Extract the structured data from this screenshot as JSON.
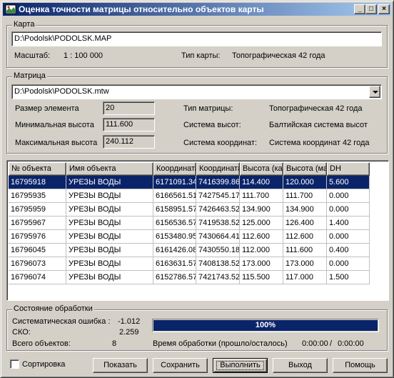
{
  "window": {
    "title": "Оценка точности матрицы относительно объектов карты",
    "min_label": "_",
    "max_label": "□",
    "close_label": "×"
  },
  "map_group": {
    "label": "Карта",
    "path": "D:\\Podolsk\\PODOLSK.MAP",
    "scale_label": "Масштаб:",
    "scale_value": "1 : 100 000",
    "type_label": "Тип карты:",
    "type_value": "Топографическая 42 года"
  },
  "matrix_group": {
    "label": "Матрица",
    "path": "D:\\Podolsk\\PODOLSK.mtw",
    "element_size_label": "Размер элемента",
    "element_size_value": "20",
    "min_height_label": "Минимальная высота",
    "min_height_value": "111.600",
    "max_height_label": "Максимальная высота",
    "max_height_value": "240.112",
    "matrix_type_label": "Тип матрицы:",
    "matrix_type_value": "Топографическая 42 года",
    "height_system_label": "Система высот:",
    "height_system_value": "Балтийская система высот",
    "coord_system_label": "Система координат:",
    "coord_system_value": "Система координат 42 года"
  },
  "table": {
    "columns": [
      "№ объекта",
      "Имя объекта",
      "Координата",
      "Координата",
      "Высота (ка",
      "Высота (ма",
      "DH"
    ],
    "rows": [
      [
        "16795918",
        "УРЕЗЫ ВОДЫ",
        "6171091.34",
        "7416399.86",
        "114.400",
        "120.000",
        "5.600"
      ],
      [
        "16795935",
        "УРЕЗЫ ВОДЫ",
        "6166561.51",
        "7427545.17",
        "111.700",
        "111.700",
        "0.000"
      ],
      [
        "16795959",
        "УРЕЗЫ ВОДЫ",
        "6158951.57",
        "7426463.52",
        "134.900",
        "134.900",
        "0.000"
      ],
      [
        "16795967",
        "УРЕЗЫ ВОДЫ",
        "6156536.57",
        "7419538.52",
        "125.000",
        "126.400",
        "1.400"
      ],
      [
        "16795976",
        "УРЕЗЫ ВОДЫ",
        "6153480.95",
        "7430664.41",
        "112.600",
        "112.600",
        "0.000"
      ],
      [
        "16796045",
        "УРЕЗЫ ВОДЫ",
        "6161426.08",
        "7430550.18",
        "112.000",
        "111.600",
        "0.400"
      ],
      [
        "16796073",
        "УРЕЗЫ ВОДЫ",
        "6163631.57",
        "7408138.52",
        "173.000",
        "173.000",
        "0.000"
      ],
      [
        "16796074",
        "УРЕЗЫ ВОДЫ",
        "6152786.57",
        "7421743.52",
        "115.500",
        "117.000",
        "1.500"
      ]
    ],
    "selected_row": 0
  },
  "status_group": {
    "label": "Состояние обработки",
    "systematic_error_label": "Систематическая ошибка :",
    "systematic_error_value": "-1.012",
    "sko_label": "СКО:",
    "sko_value": "2.259",
    "total_label": "Всего объектов:",
    "total_value": "8",
    "progress_text": "100%",
    "progress_fraction": 1.0,
    "time_label": "Время обработки  (прошло/осталось)",
    "time_elapsed": "0:00:00",
    "time_separator": "/",
    "time_remaining": "0:00:00"
  },
  "footer": {
    "sort_label": "Сортировка",
    "show_label": "Показать",
    "save_label": "Сохранить",
    "run_label": "Выполнить",
    "exit_label": "Выход",
    "help_label": "Помощь"
  },
  "colors": {
    "face": "#d4d0c8",
    "titlebar_start": "#0a246a",
    "titlebar_end": "#a6caf0",
    "selection": "#0a246a"
  }
}
